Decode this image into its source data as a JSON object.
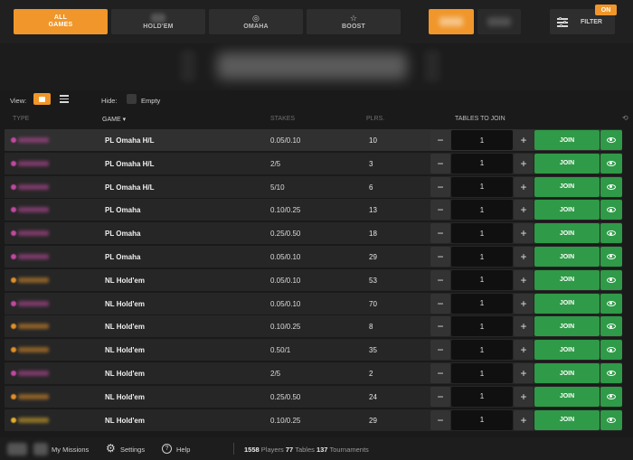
{
  "tabs": [
    {
      "label": "ALL GAMES",
      "line1": "ALL",
      "line2": "GAMES",
      "active": true
    },
    {
      "label": "HOLD'EM",
      "icon": "blurred-holdem-icon"
    },
    {
      "label": "OMAHA",
      "icon": "omaha-icon"
    },
    {
      "label": "BOOST",
      "icon": "star-icon"
    }
  ],
  "money_toggle": {
    "active": "real"
  },
  "filter": {
    "label": "FILTER",
    "badge": "ON"
  },
  "view": {
    "label": "View:",
    "hide_label": "Hide:",
    "empty_label": "Empty"
  },
  "table_header": {
    "type": "TYPE",
    "game": "GAME",
    "stakes": "STAKES",
    "players": "PLRS.",
    "tables_to_join": "TABLES TO JOIN"
  },
  "rows": [
    {
      "game": "PL Omaha H/L",
      "stakes": "0.05/0.10",
      "players": "10",
      "qty": "1",
      "join": "JOIN",
      "type_color": "#c04aa0"
    },
    {
      "game": "PL Omaha H/L",
      "stakes": "2/5",
      "players": "3",
      "qty": "1",
      "join": "JOIN",
      "type_color": "#c04aa0"
    },
    {
      "game": "PL Omaha H/L",
      "stakes": "5/10",
      "players": "6",
      "qty": "1",
      "join": "JOIN",
      "type_color": "#c04aa0"
    },
    {
      "game": "PL Omaha",
      "stakes": "0.10/0.25",
      "players": "13",
      "qty": "1",
      "join": "JOIN",
      "type_color": "#c04aa0"
    },
    {
      "game": "PL Omaha",
      "stakes": "0.25/0.50",
      "players": "18",
      "qty": "1",
      "join": "JOIN",
      "type_color": "#c04aa0"
    },
    {
      "game": "PL Omaha",
      "stakes": "0.05/0.10",
      "players": "29",
      "qty": "1",
      "join": "JOIN",
      "type_color": "#c04aa0"
    },
    {
      "game": "NL Hold'em",
      "stakes": "0.05/0.10",
      "players": "53",
      "qty": "1",
      "join": "JOIN",
      "type_color": "#e0902a"
    },
    {
      "game": "NL Hold'em",
      "stakes": "0.05/0.10",
      "players": "70",
      "qty": "1",
      "join": "JOIN",
      "type_color": "#c04aa0"
    },
    {
      "game": "NL Hold'em",
      "stakes": "0.10/0.25",
      "players": "8",
      "qty": "1",
      "join": "JOIN",
      "type_color": "#e0902a"
    },
    {
      "game": "NL Hold'em",
      "stakes": "0.50/1",
      "players": "35",
      "qty": "1",
      "join": "JOIN",
      "type_color": "#e0902a"
    },
    {
      "game": "NL Hold'em",
      "stakes": "2/5",
      "players": "2",
      "qty": "1",
      "join": "JOIN",
      "type_color": "#c04aa0"
    },
    {
      "game": "NL Hold'em",
      "stakes": "0.25/0.50",
      "players": "24",
      "qty": "1",
      "join": "JOIN",
      "type_color": "#e0902a"
    },
    {
      "game": "NL Hold'em",
      "stakes": "0.10/0.25",
      "players": "29",
      "qty": "1",
      "join": "JOIN",
      "type_color": "#e0b02a"
    }
  ],
  "footer": {
    "missions": "My Missions",
    "settings": "Settings",
    "help": "Help",
    "players_count": "1558",
    "players_label": "Players",
    "tables_count": "77",
    "tables_label": "Tables",
    "tournaments_count": "137",
    "tournaments_label": "Tournaments"
  },
  "colors": {
    "accent": "#f0962a",
    "join_green": "#2f9a47",
    "background": "#1a1a1a"
  }
}
